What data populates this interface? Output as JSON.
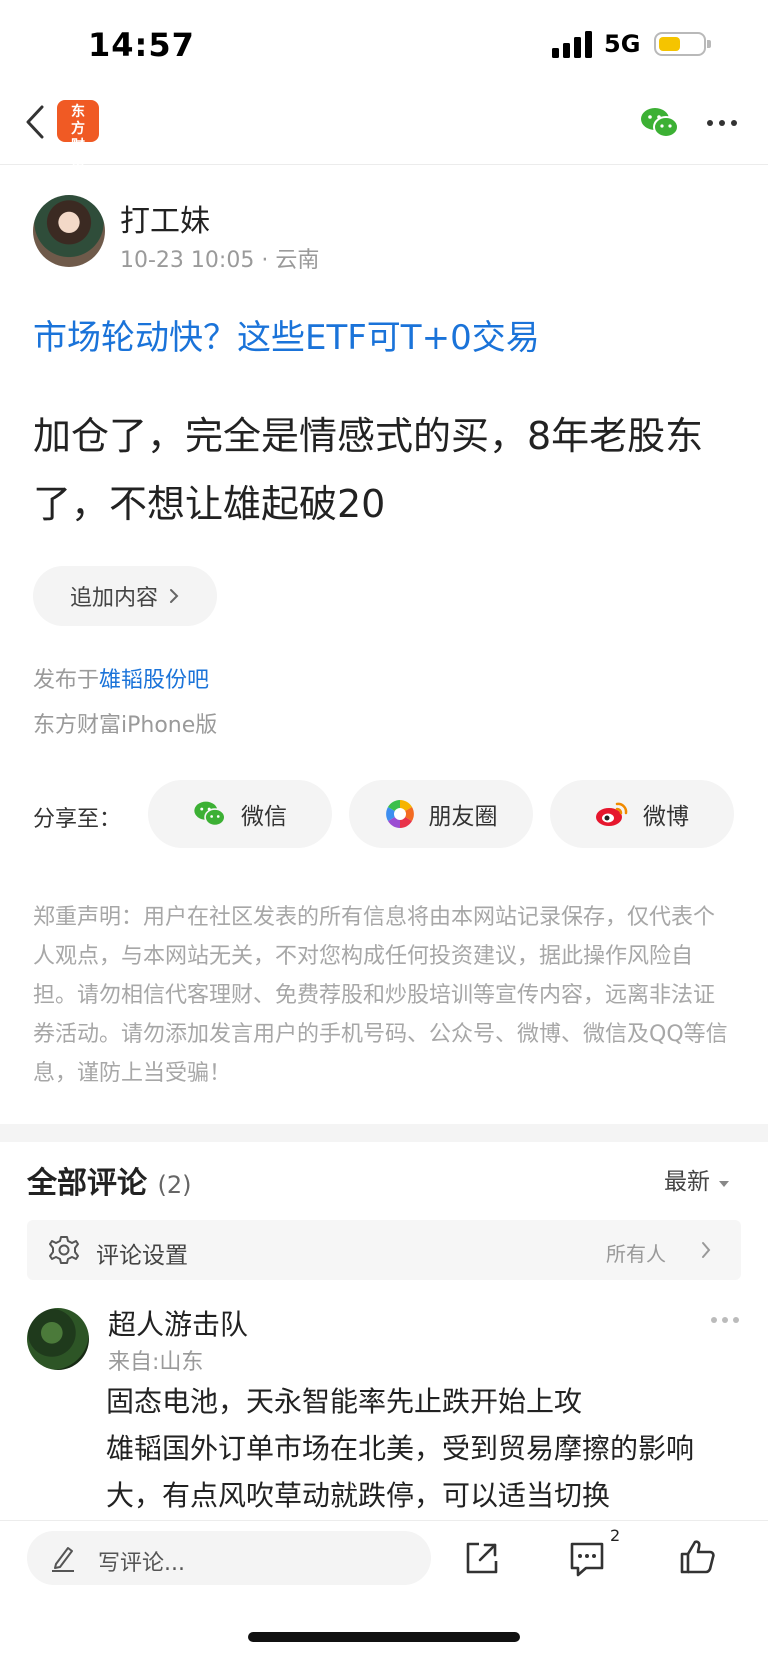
{
  "status_bar": {
    "time": "14:57",
    "network": "5G",
    "battery_level": 0.5
  },
  "nav": {
    "logo_text": "东方财富"
  },
  "post": {
    "author": "打工妹",
    "datetime": "10-23 10:05",
    "location": "云南",
    "title": "市场轮动快？这些ETF可T+0交易",
    "content": "加仓了，完全是情感式的买，8年老股东了，不想让雄起破20",
    "append_label": "追加内容",
    "published_prefix": "发布于",
    "published_in": "雄韬股份吧",
    "device": "东方财富iPhone版"
  },
  "share": {
    "label": "分享至：",
    "wechat": "微信",
    "moments": "朋友圈",
    "weibo": "微博"
  },
  "disclaimer": "郑重声明：用户在社区发表的所有信息将由本网站记录保存，仅代表个人观点，与本网站无关，不对您构成任何投资建议，据此操作风险自担。请勿相信代客理财、免费荐股和炒股培训等宣传内容，远离非法证券活动。请勿添加发言用户的手机号码、公众号、微博、微信及QQ等信息，谨防上当受骗！",
  "comments": {
    "title": "全部评论",
    "count": "(2)",
    "sort_label": "最新",
    "settings_label": "评论设置",
    "settings_value": "所有人",
    "items": [
      {
        "name": "超人游击队",
        "from": "来自:山东",
        "line1": "固态电池，天永智能率先止跌开始上攻",
        "line2": "雄韬国外订单市场在北美，受到贸易摩擦的影响大，有点风吹草动就跌停，可以适当切换"
      }
    ]
  },
  "bottom_bar": {
    "input_placeholder": "写评论...",
    "comment_badge": "2"
  }
}
